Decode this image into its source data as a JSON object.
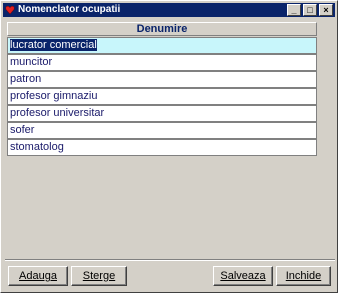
{
  "window": {
    "title": "Nomenclator ocupatii",
    "controls": {
      "minimize": "_",
      "maximize": "□",
      "close": "×"
    }
  },
  "grid": {
    "header": "Denumire",
    "rows": [
      {
        "label": "lucrator comercial",
        "selected": true
      },
      {
        "label": "muncitor"
      },
      {
        "label": "patron"
      },
      {
        "label": "profesor gimnaziu"
      },
      {
        "label": "profesor universitar"
      },
      {
        "label": "sofer"
      },
      {
        "label": "stomatolog"
      }
    ]
  },
  "buttons": {
    "add": "Adauga",
    "delete": "Sterge",
    "save": "Salveaza",
    "close": "Inchide"
  },
  "colors": {
    "titlebar": "#0a246a",
    "selection_row": "#c8f6fb",
    "text_blue": "#1a1a6a"
  }
}
